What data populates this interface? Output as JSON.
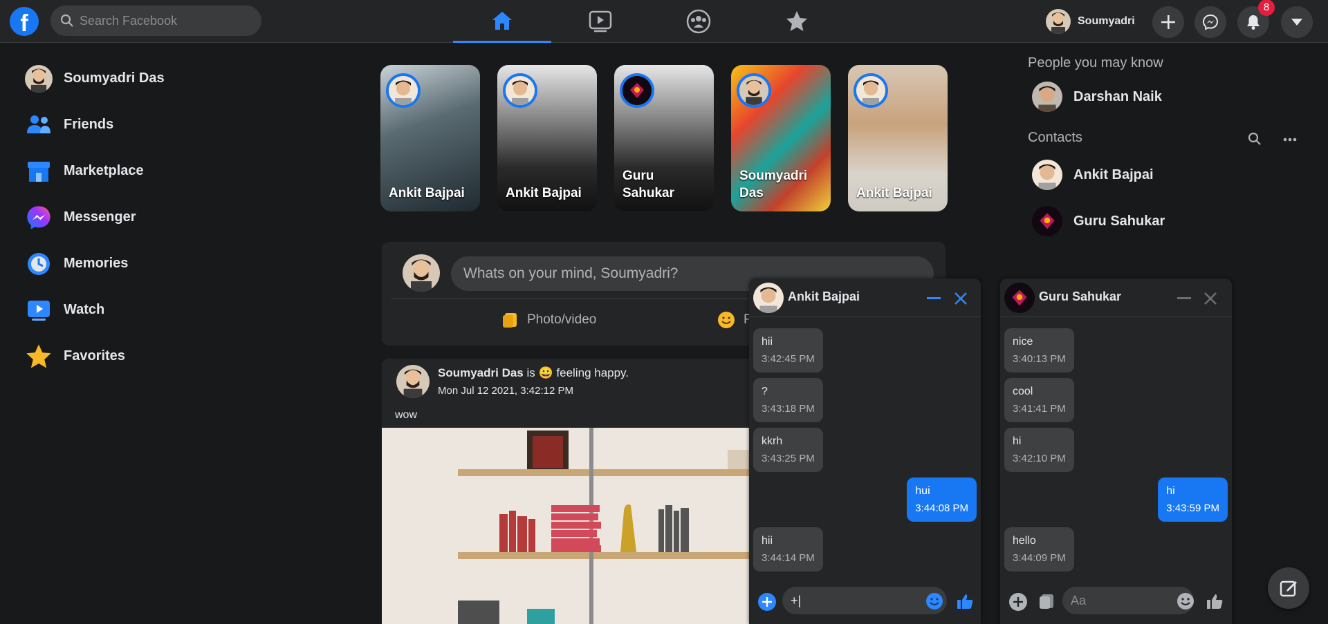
{
  "topbar": {
    "logo": "f",
    "search_placeholder": "Search Facebook",
    "user_name": "Soumyadri",
    "notification_count": "8",
    "nav_icons": [
      "home-icon",
      "watch-icon",
      "groups-icon",
      "favorites-star-icon"
    ]
  },
  "left_nav": {
    "items": [
      {
        "label": "Soumyadri Das",
        "icon": "profile-avatar"
      },
      {
        "label": "Friends",
        "icon": "friends-icon"
      },
      {
        "label": "Marketplace",
        "icon": "marketplace-icon"
      },
      {
        "label": "Messenger",
        "icon": "messenger-icon"
      },
      {
        "label": "Memories",
        "icon": "memories-clock-icon"
      },
      {
        "label": "Watch",
        "icon": "watch-icon"
      },
      {
        "label": "Favorites",
        "icon": "star-icon"
      }
    ]
  },
  "stories": [
    {
      "name": "Ankit Bajpai"
    },
    {
      "name": "Ankit Bajpai"
    },
    {
      "name": "Guru Sahukar"
    },
    {
      "name": "Soumyadri Das"
    },
    {
      "name": "Ankit Bajpai"
    }
  ],
  "composer": {
    "placeholder": "Whats on your mind, Soumyadri?",
    "photo_label": "Photo/video",
    "feeling_label": "F"
  },
  "post": {
    "author": "Soumyadri Das",
    "is": "is",
    "feeling": "feeling happy.",
    "time": "Mon Jul 12 2021, 3:42:12 PM",
    "text": "wow"
  },
  "right": {
    "people_title": "People you may know",
    "people": [
      {
        "name": "Darshan Naik"
      }
    ],
    "contacts_title": "Contacts",
    "contacts": [
      {
        "name": "Ankit Bajpai"
      },
      {
        "name": "Guru Sahukar"
      }
    ]
  },
  "chats": [
    {
      "name": "Ankit Bajpai",
      "input_value": "+|",
      "messages": [
        {
          "text": "hii",
          "time": "3:42:45 PM",
          "dir": "in"
        },
        {
          "text": "?",
          "time": "3:43:18 PM",
          "dir": "in"
        },
        {
          "text": "kkrh",
          "time": "3:43:25 PM",
          "dir": "in"
        },
        {
          "text": "hui",
          "time": "3:44:08 PM",
          "dir": "out"
        },
        {
          "text": "hii",
          "time": "3:44:14 PM",
          "dir": "in"
        }
      ]
    },
    {
      "name": "Guru Sahukar",
      "input_placeholder": "Aa",
      "messages": [
        {
          "text": "nice",
          "time": "3:40:13 PM",
          "dir": "in"
        },
        {
          "text": "cool",
          "time": "3:41:41 PM",
          "dir": "in"
        },
        {
          "text": "hi",
          "time": "3:42:10 PM",
          "dir": "in"
        },
        {
          "text": "hi",
          "time": "3:43:59 PM",
          "dir": "out"
        },
        {
          "text": "hello",
          "time": "3:44:09 PM",
          "dir": "in"
        }
      ]
    }
  ],
  "colors": {
    "accent": "#1877f2",
    "background": "#18191a",
    "surface": "#242526"
  }
}
